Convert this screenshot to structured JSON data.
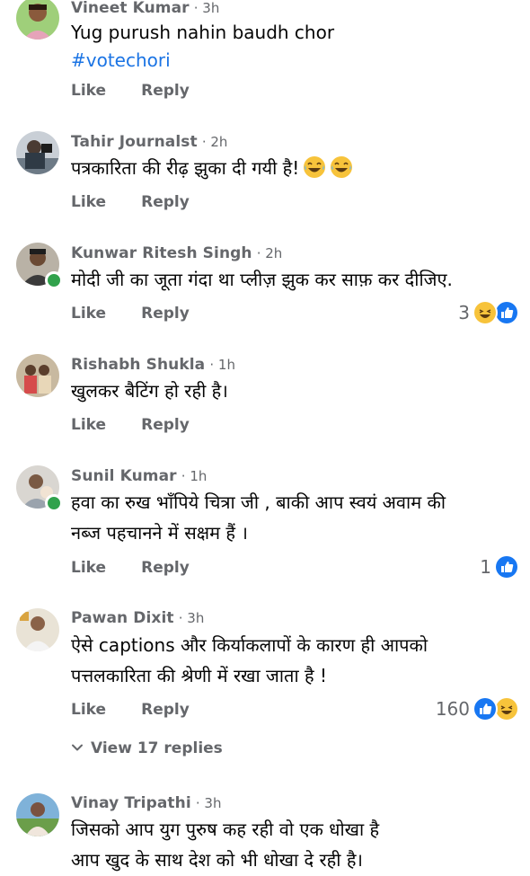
{
  "comments": [
    {
      "author": "Vineet Kumar",
      "time": "3h",
      "lines": [
        "Yug purush nahin baudh chor"
      ],
      "hashtag": "#votechori",
      "like": "Like",
      "reply": "Reply"
    },
    {
      "author": "Tahir Journalst",
      "time": "2h",
      "lines": [
        "पत्रकारिता की रीढ़ झुका दी गयी है!"
      ],
      "emoji": [
        "laughing-tears-emoji",
        "laughing-tears-emoji"
      ],
      "like": "Like",
      "reply": "Reply"
    },
    {
      "author": "Kunwar Ritesh Singh",
      "time": "2h",
      "lines": [
        "मोदी जी का जूता गंदा था प्लीज़ झुक कर साफ़ कर दीजिए."
      ],
      "like": "Like",
      "reply": "Reply",
      "reaction_count": "3",
      "reactions": [
        "haha-reaction-icon",
        "like-reaction-icon"
      ]
    },
    {
      "author": "Rishabh Shukla",
      "time": "1h",
      "lines": [
        "खुलकर बैटिंग हो रही है।"
      ],
      "like": "Like",
      "reply": "Reply"
    },
    {
      "author": "Sunil Kumar",
      "time": "1h",
      "lines": [
        "हवा का रुख भाँपिये चित्रा जी , बाकी आप स्वयं अवाम की",
        "नब्ज पहचानने में सक्षम हैं ।"
      ],
      "like": "Like",
      "reply": "Reply",
      "reaction_count": "1",
      "reactions": [
        "like-reaction-icon"
      ]
    },
    {
      "author": "Pawan Dixit",
      "time": "3h",
      "lines": [
        "ऐसे captions और किर्याकलापों के कारण ही आपको",
        "पत्तलकारिता की श्रेणी में रखा जाता है !"
      ],
      "like": "Like",
      "reply": "Reply",
      "reaction_count": "160",
      "reactions": [
        "like-reaction-icon",
        "haha-reaction-icon"
      ],
      "view_replies": "View 17 replies"
    },
    {
      "author": "Vinay Tripathi",
      "time": "3h",
      "lines": [
        "जिसको आप युग पुरुष कह रही वो एक धोखा है",
        "आप खुद के साथ देश को भी धोखा दे रही है।"
      ]
    }
  ],
  "separator": "·",
  "colors": {
    "meta_gray": "#65676b",
    "text": "#050505",
    "link_blue": "#1b74e4",
    "like_blue": "#1877f2",
    "haha_yellow": "#f7c33b",
    "online_green": "#31a24c"
  }
}
